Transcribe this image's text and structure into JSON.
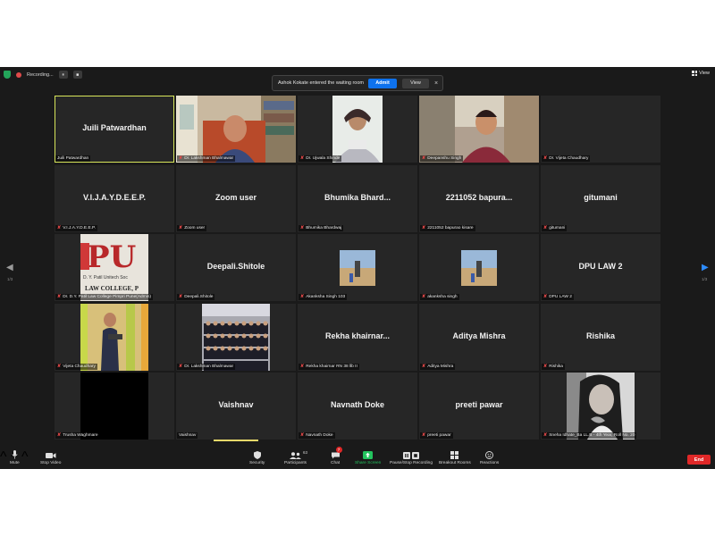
{
  "topbar": {
    "recording_label": "Recording...",
    "pause_glyph": "⏸",
    "stop_glyph": "■",
    "view_label": "View"
  },
  "notification": {
    "message": "Ashok Kokate entered the waiting room",
    "admit_label": "Admit",
    "view_label": "View",
    "close_glyph": "×"
  },
  "gallery": {
    "tiles": [
      {
        "name": "Juili Patwardhan",
        "label": "Juili Patwardhan",
        "muted": false
      },
      {
        "name": "",
        "label": "Dr. Lakshman Bhalmawar",
        "muted": true
      },
      {
        "name": "",
        "label": "Dr. Ujwala Shinde",
        "muted": true
      },
      {
        "name": "",
        "label": "Deepanshu Singh",
        "muted": true
      },
      {
        "name": "",
        "label": "Dr. Vijeta Chaudhary",
        "muted": true
      },
      {
        "name": "V.I.J.A.Y.D.E.E.P.",
        "label": "V.I.J.A.Y.D.E.E.P.",
        "muted": true
      },
      {
        "name": "Zoom user",
        "label": "Zoom user",
        "muted": true
      },
      {
        "name": "Bhumika  Bhard...",
        "label": "Bhumika Bhardwaj",
        "muted": true
      },
      {
        "name": "2211052 bapura...",
        "label": "2211052 bapurao kisare",
        "muted": true
      },
      {
        "name": "gitumani",
        "label": "gitumani",
        "muted": true
      },
      {
        "name": "",
        "label": "Dr. D.Y. Patil Law College Pimpri Pune(Admin)",
        "muted": true
      },
      {
        "name": "Deepali.Shitole",
        "label": "Deepali.Shitole",
        "muted": true
      },
      {
        "name": "",
        "label": "Akanksha Singh 103",
        "muted": true
      },
      {
        "name": "",
        "label": "akanksha singh",
        "muted": true
      },
      {
        "name": "DPU LAW 2",
        "label": "DPU LAW 2",
        "muted": true
      },
      {
        "name": "",
        "label": "Vijeta Chaudhary",
        "muted": true
      },
      {
        "name": "",
        "label": "Dr. Lakshman Bhalmawar",
        "muted": true
      },
      {
        "name": "Rekha  khairnar...",
        "label": "Rekha  khairnar RN 38 llb II",
        "muted": true
      },
      {
        "name": "Aditya Mishra",
        "label": "Aditya Mishra",
        "muted": true
      },
      {
        "name": "Rishika",
        "label": "Rishika",
        "muted": true
      },
      {
        "name": "",
        "label": "Trusha Waghmare",
        "muted": true
      },
      {
        "name": "Vaishnav",
        "label": "Vaishnav",
        "muted": false
      },
      {
        "name": "Navnath Doke",
        "label": "Navnath Doke",
        "muted": true
      },
      {
        "name": "preeti pawar",
        "label": "preeti pawar",
        "muted": true
      },
      {
        "name": "",
        "label": "Sneha Idhate_Ba LL.B - 4th Year, Roll No. 20",
        "muted": true
      }
    ],
    "logo_text": "PU",
    "logo_sub": "D. Y. Patil Unitech Soc",
    "logo_college": "LAW COLLEGE, P"
  },
  "nav": {
    "left_glyph": "◀",
    "right_glyph": "▶",
    "left_page": "1/3",
    "right_page": "1/3"
  },
  "toolbar": {
    "mute": "Mute",
    "stop_video": "Stop Video",
    "security": "Security",
    "participants": "Participants",
    "participants_count": "63",
    "chat": "Chat",
    "chat_badge": "7",
    "share_screen": "Share Screen",
    "pause_recording": "Pause/Stop Recording",
    "breakout_rooms": "Breakout Rooms",
    "reactions": "Reactions",
    "end": "End",
    "caret": "^"
  },
  "colors": {
    "accent_blue": "#0e72ed",
    "share_green": "#23c45e",
    "end_red": "#e02828",
    "active_speaker": "#d8e65a"
  }
}
